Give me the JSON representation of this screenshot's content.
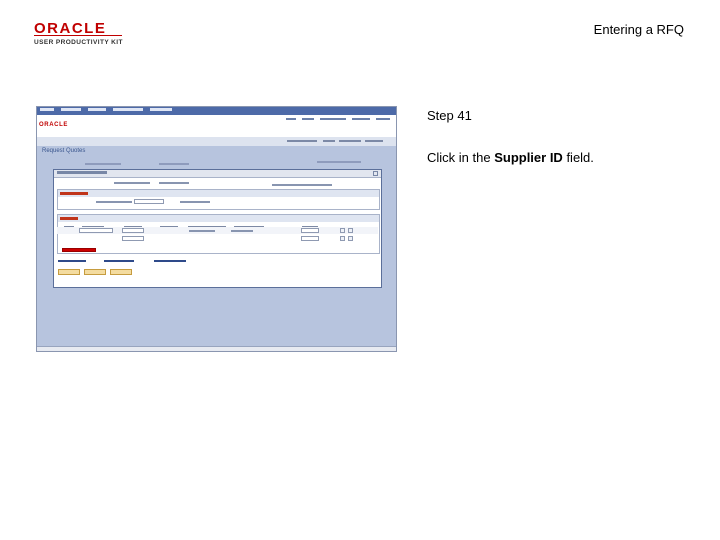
{
  "slide": {
    "title": "Entering a RFQ",
    "logo": {
      "brand": "ORACLE",
      "product": "USER PRODUCTIVITY KIT"
    }
  },
  "screenshot": {
    "app_logo": "ORACLE",
    "page_title": "Request Quotes",
    "highlighted_field": "supplier-id-input"
  },
  "instruction": {
    "step": "Step 41",
    "prefix": "Click in the ",
    "field_name": "Supplier ID",
    "suffix": " field."
  },
  "colors": {
    "oracle_red": "#c00000",
    "highlight_red": "#cc0000",
    "screen_bg": "#b7c4de",
    "menubar": "#4d6aa8"
  }
}
